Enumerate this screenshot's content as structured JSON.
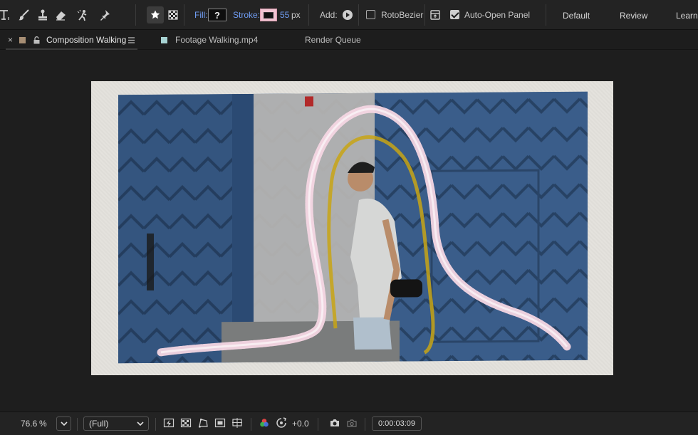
{
  "toolbar": {
    "fill_label": "Fill:",
    "fill_value": "?",
    "stroke_label": "Stroke:",
    "stroke_width": "55",
    "stroke_unit": "px",
    "stroke_color": "#f1c4d2",
    "add_label": "Add:",
    "rotobezier_label": "RotoBezier",
    "rotobezier_checked": false,
    "auto_open_label": "Auto-Open Panel",
    "auto_open_checked": true,
    "workspaces": [
      "Default",
      "Review",
      "Learn"
    ],
    "tools": [
      "type-tool-icon",
      "brush-tool-icon",
      "clone-stamp-icon",
      "eraser-icon",
      "roto-brush-icon",
      "puppet-pin-icon",
      "star-icon",
      "checker-icon"
    ]
  },
  "tabs": {
    "composition": {
      "label": "Composition Walking",
      "swatch": "#a78e74"
    },
    "footage": {
      "label": "Footage Walking.mp4",
      "swatch": "#a7d3d3"
    },
    "render": {
      "label": "Render Queue"
    }
  },
  "viewer": {
    "stroke_color": "#f4d6e3",
    "path_color": "#c8a515",
    "background_color": "#e4e2dd"
  },
  "bottombar": {
    "zoom_value": "76.6",
    "zoom_unit": "%",
    "resolution": "(Full)",
    "exposure": "+0.0",
    "timecode": "0:00:03:09"
  },
  "colors": {
    "accent": "#6f9cf2",
    "panel": "#232323",
    "background": "#1d1d1d"
  }
}
